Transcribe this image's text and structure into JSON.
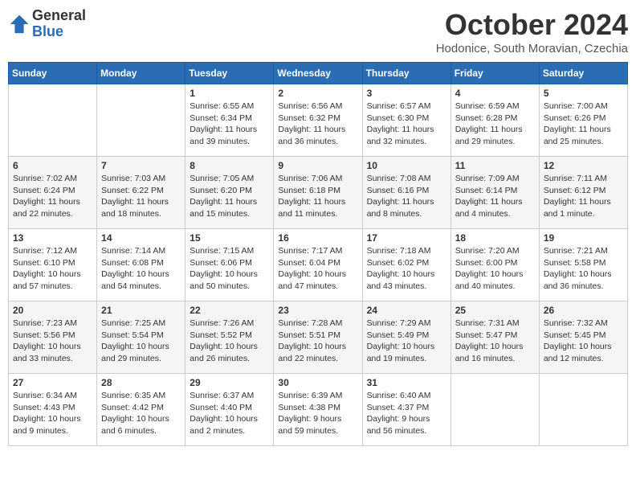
{
  "logo": {
    "general": "General",
    "blue": "Blue"
  },
  "title": "October 2024",
  "location": "Hodonice, South Moravian, Czechia",
  "days_of_week": [
    "Sunday",
    "Monday",
    "Tuesday",
    "Wednesday",
    "Thursday",
    "Friday",
    "Saturday"
  ],
  "weeks": [
    [
      {
        "day": "",
        "info": ""
      },
      {
        "day": "",
        "info": ""
      },
      {
        "day": "1",
        "info": "Sunrise: 6:55 AM\nSunset: 6:34 PM\nDaylight: 11 hours and 39 minutes."
      },
      {
        "day": "2",
        "info": "Sunrise: 6:56 AM\nSunset: 6:32 PM\nDaylight: 11 hours and 36 minutes."
      },
      {
        "day": "3",
        "info": "Sunrise: 6:57 AM\nSunset: 6:30 PM\nDaylight: 11 hours and 32 minutes."
      },
      {
        "day": "4",
        "info": "Sunrise: 6:59 AM\nSunset: 6:28 PM\nDaylight: 11 hours and 29 minutes."
      },
      {
        "day": "5",
        "info": "Sunrise: 7:00 AM\nSunset: 6:26 PM\nDaylight: 11 hours and 25 minutes."
      }
    ],
    [
      {
        "day": "6",
        "info": "Sunrise: 7:02 AM\nSunset: 6:24 PM\nDaylight: 11 hours and 22 minutes."
      },
      {
        "day": "7",
        "info": "Sunrise: 7:03 AM\nSunset: 6:22 PM\nDaylight: 11 hours and 18 minutes."
      },
      {
        "day": "8",
        "info": "Sunrise: 7:05 AM\nSunset: 6:20 PM\nDaylight: 11 hours and 15 minutes."
      },
      {
        "day": "9",
        "info": "Sunrise: 7:06 AM\nSunset: 6:18 PM\nDaylight: 11 hours and 11 minutes."
      },
      {
        "day": "10",
        "info": "Sunrise: 7:08 AM\nSunset: 6:16 PM\nDaylight: 11 hours and 8 minutes."
      },
      {
        "day": "11",
        "info": "Sunrise: 7:09 AM\nSunset: 6:14 PM\nDaylight: 11 hours and 4 minutes."
      },
      {
        "day": "12",
        "info": "Sunrise: 7:11 AM\nSunset: 6:12 PM\nDaylight: 11 hours and 1 minute."
      }
    ],
    [
      {
        "day": "13",
        "info": "Sunrise: 7:12 AM\nSunset: 6:10 PM\nDaylight: 10 hours and 57 minutes."
      },
      {
        "day": "14",
        "info": "Sunrise: 7:14 AM\nSunset: 6:08 PM\nDaylight: 10 hours and 54 minutes."
      },
      {
        "day": "15",
        "info": "Sunrise: 7:15 AM\nSunset: 6:06 PM\nDaylight: 10 hours and 50 minutes."
      },
      {
        "day": "16",
        "info": "Sunrise: 7:17 AM\nSunset: 6:04 PM\nDaylight: 10 hours and 47 minutes."
      },
      {
        "day": "17",
        "info": "Sunrise: 7:18 AM\nSunset: 6:02 PM\nDaylight: 10 hours and 43 minutes."
      },
      {
        "day": "18",
        "info": "Sunrise: 7:20 AM\nSunset: 6:00 PM\nDaylight: 10 hours and 40 minutes."
      },
      {
        "day": "19",
        "info": "Sunrise: 7:21 AM\nSunset: 5:58 PM\nDaylight: 10 hours and 36 minutes."
      }
    ],
    [
      {
        "day": "20",
        "info": "Sunrise: 7:23 AM\nSunset: 5:56 PM\nDaylight: 10 hours and 33 minutes."
      },
      {
        "day": "21",
        "info": "Sunrise: 7:25 AM\nSunset: 5:54 PM\nDaylight: 10 hours and 29 minutes."
      },
      {
        "day": "22",
        "info": "Sunrise: 7:26 AM\nSunset: 5:52 PM\nDaylight: 10 hours and 26 minutes."
      },
      {
        "day": "23",
        "info": "Sunrise: 7:28 AM\nSunset: 5:51 PM\nDaylight: 10 hours and 22 minutes."
      },
      {
        "day": "24",
        "info": "Sunrise: 7:29 AM\nSunset: 5:49 PM\nDaylight: 10 hours and 19 minutes."
      },
      {
        "day": "25",
        "info": "Sunrise: 7:31 AM\nSunset: 5:47 PM\nDaylight: 10 hours and 16 minutes."
      },
      {
        "day": "26",
        "info": "Sunrise: 7:32 AM\nSunset: 5:45 PM\nDaylight: 10 hours and 12 minutes."
      }
    ],
    [
      {
        "day": "27",
        "info": "Sunrise: 6:34 AM\nSunset: 4:43 PM\nDaylight: 10 hours and 9 minutes."
      },
      {
        "day": "28",
        "info": "Sunrise: 6:35 AM\nSunset: 4:42 PM\nDaylight: 10 hours and 6 minutes."
      },
      {
        "day": "29",
        "info": "Sunrise: 6:37 AM\nSunset: 4:40 PM\nDaylight: 10 hours and 2 minutes."
      },
      {
        "day": "30",
        "info": "Sunrise: 6:39 AM\nSunset: 4:38 PM\nDaylight: 9 hours and 59 minutes."
      },
      {
        "day": "31",
        "info": "Sunrise: 6:40 AM\nSunset: 4:37 PM\nDaylight: 9 hours and 56 minutes."
      },
      {
        "day": "",
        "info": ""
      },
      {
        "day": "",
        "info": ""
      }
    ]
  ]
}
